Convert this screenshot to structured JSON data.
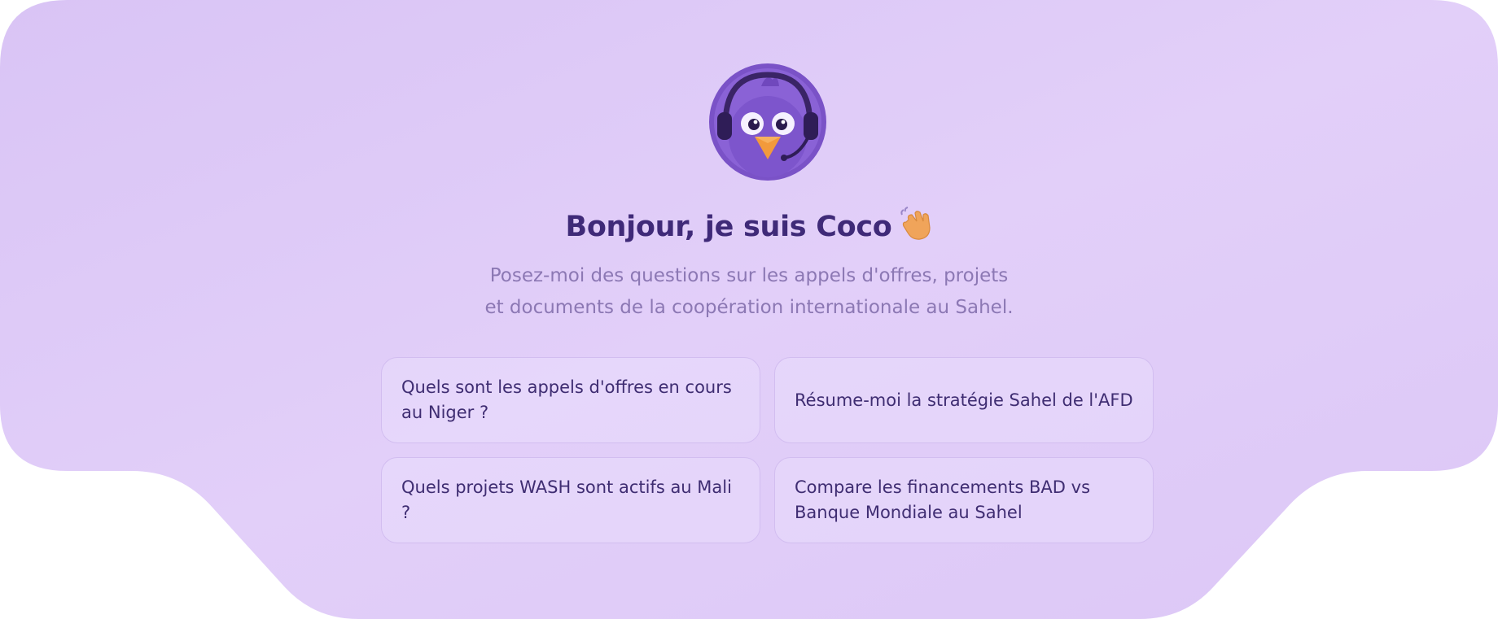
{
  "assistant": {
    "greeting": "Bonjour, je suis Coco",
    "greeting_emoji": "waving-hand-icon",
    "avatar": "coco-bird-headset-avatar",
    "subtitle_line1": "Posez-moi des questions sur les appels d'offres, projets",
    "subtitle_line2": "et documents de la coopération internationale au Sahel."
  },
  "suggestions": [
    {
      "label": "Quels sont les appels d'offres en cours au Niger ?"
    },
    {
      "label": "Résume-moi la stratégie Sahel de l'AFD"
    },
    {
      "label": "Quels projets WASH sont actifs au Mali ?"
    },
    {
      "label": "Compare les financements BAD vs Banque Mondiale au Sahel"
    }
  ],
  "colors": {
    "background": "#dfcaf6",
    "title": "#3f2a78",
    "subtitle": "#8c78b4",
    "card_border": "#d2bdf0",
    "card_text": "#3f2d72"
  }
}
